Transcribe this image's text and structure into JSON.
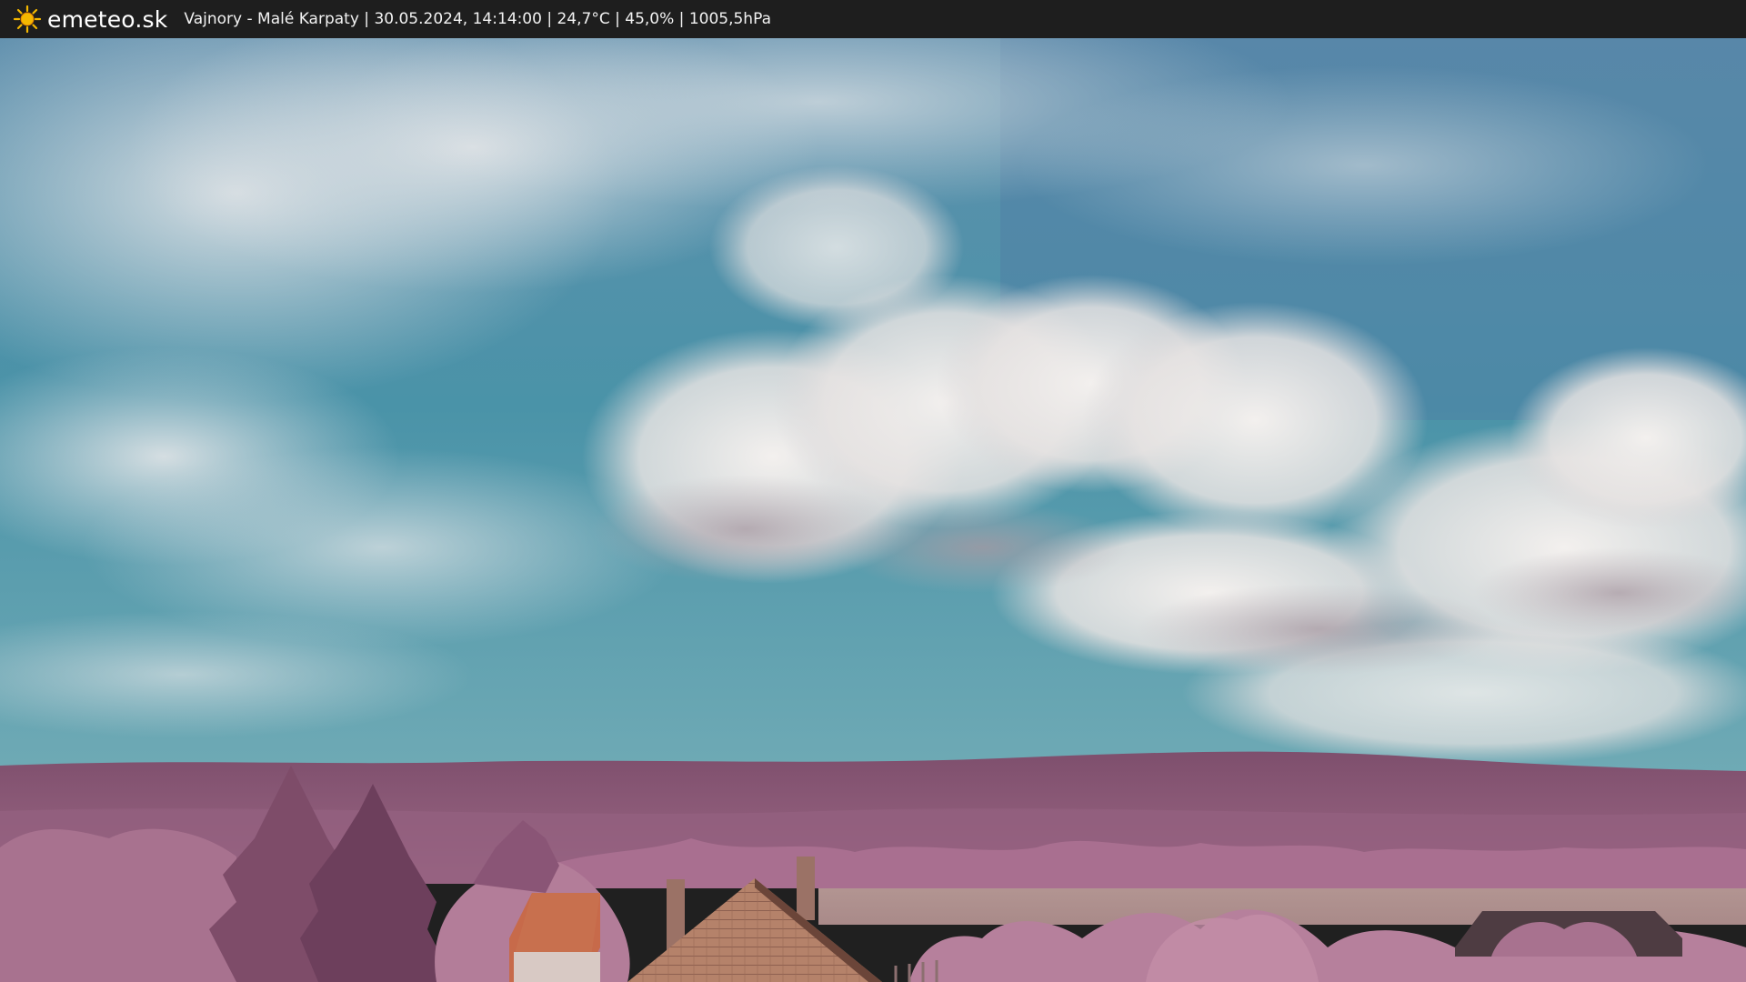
{
  "header": {
    "brand": "emeteo.sk",
    "brand_icon": "sun-icon",
    "station": "Vajnory - Malé Karpaty",
    "sep1": " | ",
    "datetime": "30.05.2024, 14:14:00",
    "sep2": " | ",
    "temperature": "24,7°C",
    "sep3": " | ",
    "humidity": "45,0%",
    "sep4": " | ",
    "pressure": "1005,5hPa"
  },
  "colors": {
    "bar": "#1e1e1e",
    "sun": "#f5b800",
    "sky_blue": "#3f8ea5",
    "cloud": "#ece7e4",
    "hills": "#8a5a78",
    "foliage": "#b77f9c",
    "roof": "#b37a5c"
  }
}
